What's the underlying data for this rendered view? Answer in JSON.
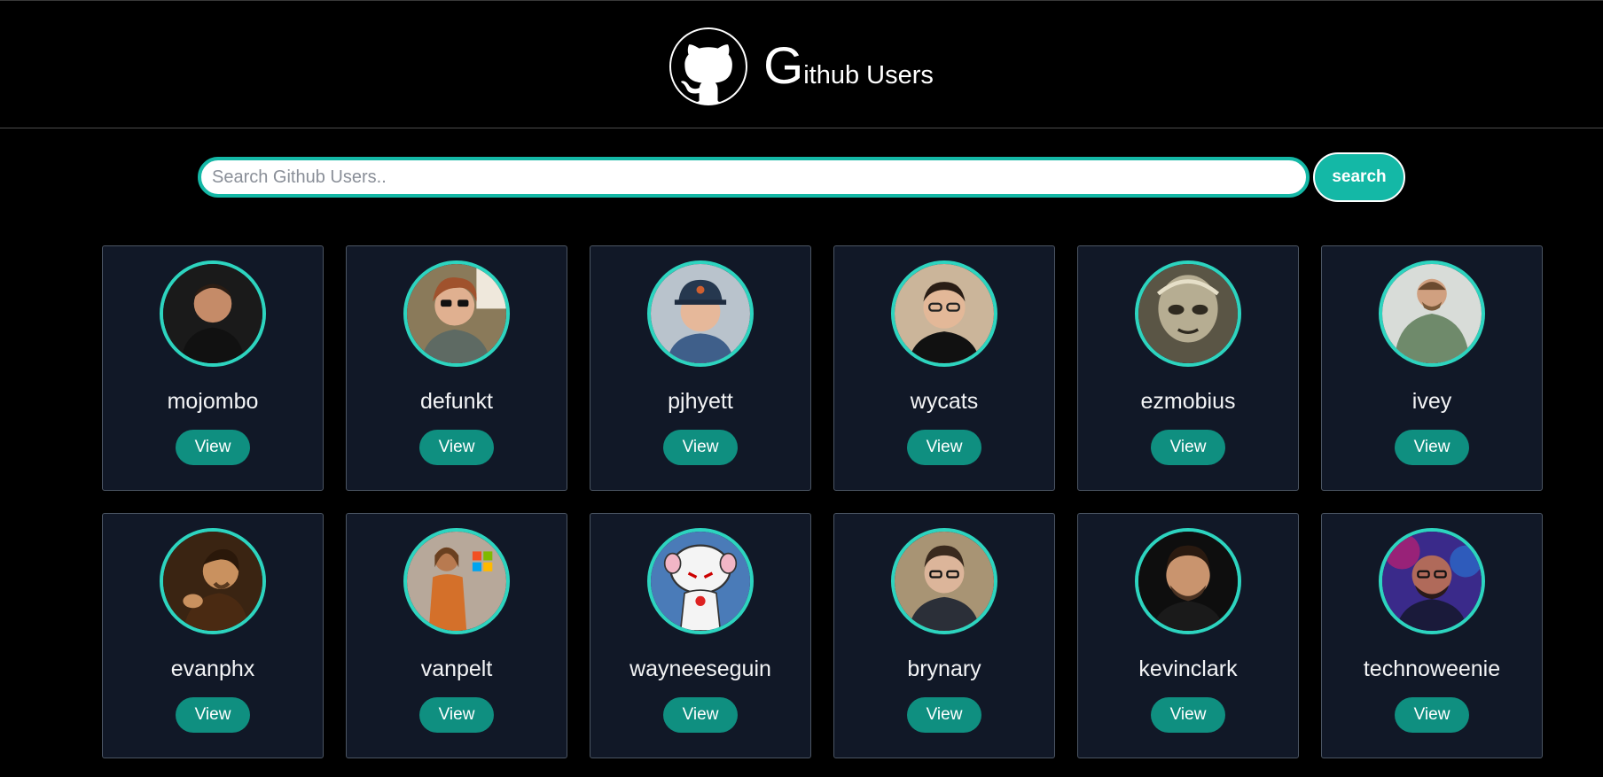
{
  "header": {
    "logo_icon": "github-octocat-icon",
    "title_initial": "G",
    "title_rest": "ithub Users"
  },
  "search": {
    "placeholder": "Search Github Users..",
    "value": "",
    "button_label": "search"
  },
  "colors": {
    "accent": "#14b8a6",
    "card_bg": "#111827",
    "button": "#0f8f80",
    "page_bg": "#000000"
  },
  "users": [
    {
      "login": "mojombo",
      "view_label": "View"
    },
    {
      "login": "defunkt",
      "view_label": "View"
    },
    {
      "login": "pjhyett",
      "view_label": "View"
    },
    {
      "login": "wycats",
      "view_label": "View"
    },
    {
      "login": "ezmobius",
      "view_label": "View"
    },
    {
      "login": "ivey",
      "view_label": "View"
    },
    {
      "login": "evanphx",
      "view_label": "View"
    },
    {
      "login": "vanpelt",
      "view_label": "View"
    },
    {
      "login": "wayneeseguin",
      "view_label": "View"
    },
    {
      "login": "brynary",
      "view_label": "View"
    },
    {
      "login": "kevinclark",
      "view_label": "View"
    },
    {
      "login": "technoweenie",
      "view_label": "View"
    }
  ]
}
